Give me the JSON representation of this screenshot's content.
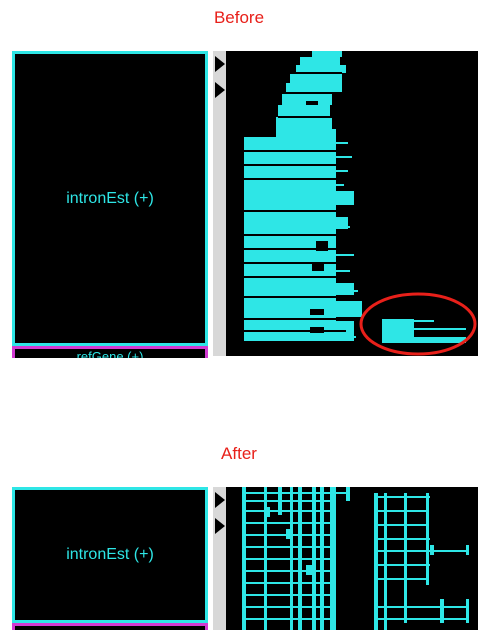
{
  "before": {
    "heading": "Before",
    "track_label": "intronEst (+)",
    "next_track_label": "refGene (+)",
    "callout": "red-ellipse-highlight"
  },
  "after": {
    "heading": "After",
    "track_label": "intronEst (+)"
  },
  "icons": {
    "expand_arrows": "right-triangle-icon"
  },
  "colors": {
    "track_feature": "#2ee6e6",
    "next_track_border": "#d23ad2",
    "heading": "#e8201a",
    "highlight": "#e8201a"
  }
}
